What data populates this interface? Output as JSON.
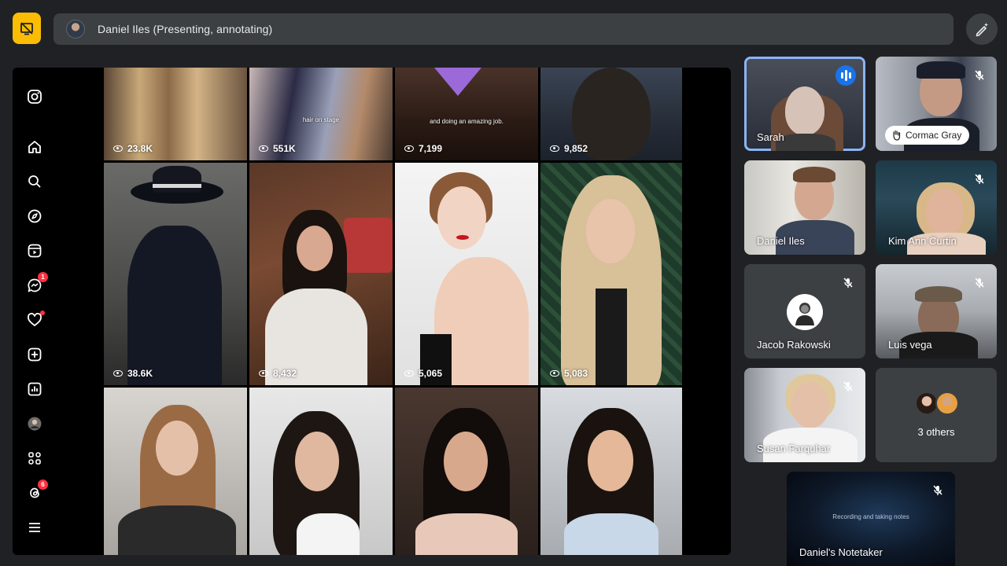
{
  "topbar": {
    "presenter_text": "Daniel Iles (Presenting, annotating)"
  },
  "instagram": {
    "rail_icons": [
      "instagram-logo",
      "home",
      "search",
      "explore",
      "reels",
      "messages",
      "notifications",
      "create",
      "dashboard",
      "profile",
      "also-from-meta",
      "threads",
      "more"
    ],
    "message_badge": "1",
    "threads_badge": "6"
  },
  "reels": [
    {
      "views": "23.8K"
    },
    {
      "views": "551K",
      "caption": "hair on stage"
    },
    {
      "views": "7,199",
      "caption": "and doing an amazing job."
    },
    {
      "views": "9,852"
    },
    {
      "views": "38.6K"
    },
    {
      "views": "8,432"
    },
    {
      "views": "5,065"
    },
    {
      "views": "5,083"
    },
    {},
    {},
    {},
    {}
  ],
  "participants": [
    {
      "name": "Sarah",
      "state": "speaking"
    },
    {
      "name": "Cormac Gray",
      "state": "hand-raised-muted"
    },
    {
      "name": "Daniel Iles",
      "state": "unmuted"
    },
    {
      "name": "Kim Ann Curtin",
      "state": "muted"
    },
    {
      "name": "Jacob Rakowski",
      "state": "muted"
    },
    {
      "name": "Luis vega",
      "state": "muted"
    },
    {
      "name": "Susan Farquhar",
      "state": "muted"
    },
    {
      "name": "3 others",
      "state": "group"
    }
  ],
  "notetaker": {
    "name": "Daniel's Notetaker",
    "subtitle": "Recording and taking notes"
  },
  "colors": {
    "background": "#202124",
    "surface": "#3c4043",
    "stop_button": "#fbbc04",
    "speaking_blue": "#1a73e8",
    "active_border": "#8ab4f8"
  }
}
